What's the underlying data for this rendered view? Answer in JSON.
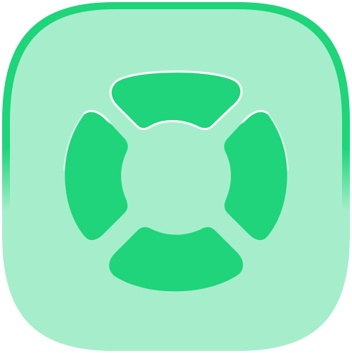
{
  "icon": {
    "name": "lifebuoy-icon",
    "colors": {
      "background": "#ffffff",
      "tile_fill": "#a6eecb",
      "tile_border": "#1fd47a",
      "buoy": "#1fd47a",
      "highlight": "#ffffff"
    }
  }
}
